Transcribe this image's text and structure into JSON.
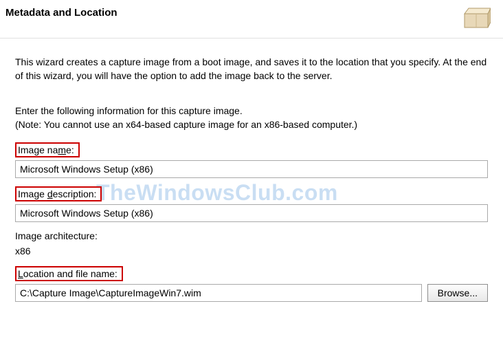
{
  "header": {
    "title": "Metadata and Location"
  },
  "intro": {
    "line": "This wizard creates a capture image from a boot image, and saves it to the location that you specify. At the end of this wizard, you will have the option to add the image back to the server."
  },
  "subintro": {
    "line1": "Enter the following information for this capture image.",
    "line2": "(Note: You cannot use an x64-based capture image for an x86-based computer.)"
  },
  "fields": {
    "image_name_label_pre": "Image na",
    "image_name_label_key": "m",
    "image_name_label_post": "e:",
    "image_name_value": "Microsoft Windows Setup (x86)",
    "image_desc_label_pre": "Image ",
    "image_desc_label_key": "d",
    "image_desc_label_post": "escription:",
    "image_desc_value": "Microsoft Windows Setup (x86)",
    "image_arch_label": "Image architecture:",
    "image_arch_value": "x86",
    "location_label_pre": "",
    "location_label_key": "L",
    "location_label_post": "ocation and file name:",
    "location_value": "C:\\Capture Image\\CaptureImageWin7.wim",
    "browse_label": "Browse..."
  },
  "watermark": "TheWindowsClub.com"
}
